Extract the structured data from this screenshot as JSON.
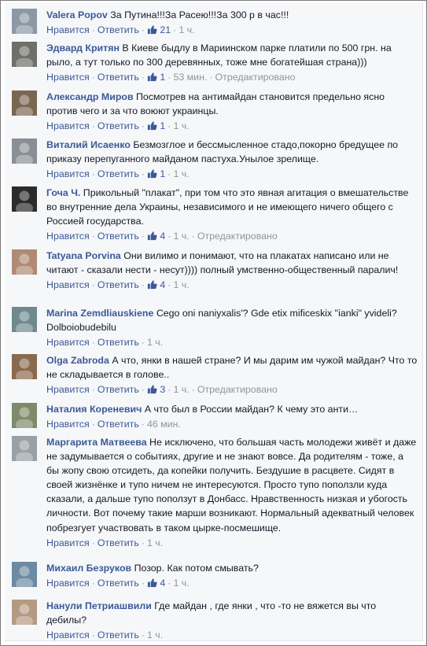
{
  "actions": {
    "like": "Нравится",
    "reply": "Ответить",
    "edited": "Отредактировано",
    "dot": "·"
  },
  "colors": {
    "link": "#3b5998",
    "meta": "#90949c",
    "text": "#141823",
    "background": "#f6f7f9"
  },
  "comments": [
    {
      "author": "Valera Popov",
      "text": "За Путина!!!За Расею!!!За 300 р в час!!!",
      "likes": "21",
      "time": "1 ч.",
      "edited": false
    },
    {
      "author": "Эдвард Критян",
      "text": "В Киеве быдлу в Мариинском парке платили по 500 грн. на рыло, а тут только по 300 деревянных, тоже мне богатейшая страна)))",
      "likes": "1",
      "time": "53 мин.",
      "edited": true
    },
    {
      "author": "Александр Миров",
      "text": "Посмотрев на антимайдан становится предельно ясно против чего и за что воюют украинцы.",
      "likes": "1",
      "time": "1 ч.",
      "edited": false
    },
    {
      "author": "Виталий Исаенко",
      "text": "Безмозглое и бессмысленное стадо,покорно бредущее по приказу перепуганного майданом пастуха.Унылое зрелище.",
      "likes": "1",
      "time": "1 ч.",
      "edited": false
    },
    {
      "author": "Гоча Ч.",
      "text": "Прикольный \"плакат\", при том что это явная агитация о вмешательстве во внутренние дела Украины, независимого и не имеющего ничего общего с Россией государства.",
      "likes": "4",
      "time": "1 ч.",
      "edited": true
    },
    {
      "author": "Tatyana Porvina",
      "text": "Они вилимо и понимают, что на плакатах написано или не читают - сказали нести - несут)))) полный умственно-общественный паралич!",
      "likes": "4",
      "time": "1 ч.",
      "edited": false
    },
    {
      "author": "Marina Zemdliauskiene",
      "text": "Cego oni naniyxalis'? Gde etix mificeskix \"ianki\" yvideli? Dolboiobudebilu",
      "likes": "",
      "time": "1 ч.",
      "edited": false
    },
    {
      "author": "Olga Zabroda",
      "text": "А что, янки в нашей стране? И мы дарим им чужой майдан? Что то не складывается в голове..",
      "likes": "3",
      "time": "1 ч.",
      "edited": true
    },
    {
      "author": "Наталия Кореневич",
      "text": "А что был в России майдан? К чему это анти…",
      "likes": "",
      "time": "46 мин.",
      "edited": false
    },
    {
      "author": "Маргарита Матвеева",
      "text": "Не исключено, что большая часть молодежи живёт и даже не задумывается о событиях, другие и не знают вовсе. Да родителям - тоже, а бы жопу свою отсидеть, да копейки получить. Бездушие в расцвете. Сидят в своей жизнёнке и тупо ничем не интересуются. Просто тупо поползли куда сказали, а дальше тупо поползут в Донбасс. Нравственность низкая и убогость личности. Вот почему такие марши возникают. Нормальный адекватный человек побрезгует участвовать в таком цырке-посмешище.",
      "likes": "",
      "time": "1 ч.",
      "edited": false
    },
    {
      "author": "Михаил Безруков",
      "text": "Позор. Как потом смывать?",
      "likes": "4",
      "time": "1 ч.",
      "edited": false
    },
    {
      "author": "Нанули Петриашвили",
      "text": "Где майдан , где янки , что -то не вяжется вы что дебилы?",
      "likes": "",
      "time": "1 ч.",
      "edited": false
    }
  ]
}
